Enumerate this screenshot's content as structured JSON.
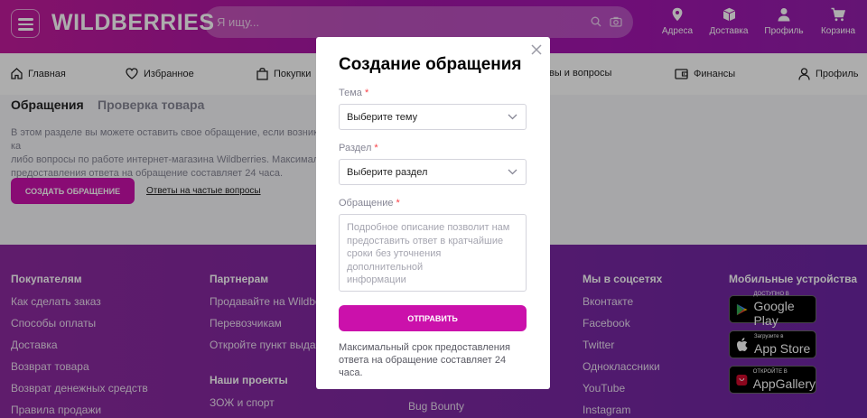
{
  "header": {
    "logo": "WILDBERRIES",
    "search_placeholder": "Я ищу...",
    "nav": [
      {
        "label": "Адреса",
        "icon": "location-icon"
      },
      {
        "label": "Доставка",
        "icon": "box-icon"
      },
      {
        "label": "Профиль",
        "icon": "user-icon"
      },
      {
        "label": "Корзина",
        "icon": "cart-icon"
      }
    ]
  },
  "main_nav": [
    {
      "label": "Главная",
      "icon": "home-icon"
    },
    {
      "label": "Избранное",
      "icon": "heart-icon"
    },
    {
      "label": "Покупки",
      "icon": "bag-icon"
    },
    {
      "label": "вы и вопросы",
      "icon": ""
    },
    {
      "label": "Финансы",
      "icon": "wallet-icon"
    },
    {
      "label": "Профиль",
      "icon": "user-icon"
    }
  ],
  "page": {
    "tabs": [
      "Обращения",
      "Проверка товара"
    ],
    "intro_lines": [
      "В этом разделе вы можете оставить свое обращение, если возникли ка",
      "либо вопросы по работе интернет-магазина Wildberries. Максимальн",
      "предоставления ответа на обращение составляет 24 часа."
    ],
    "create_button": "СОЗДАТЬ ОБРАЩЕНИЕ",
    "faq_link": "Ответы на частые вопросы"
  },
  "footer": {
    "columns": [
      {
        "heading": "Покупателям",
        "links": [
          "Как сделать заказ",
          "Способы оплаты",
          "Доставка",
          "Возврат товара",
          "Возврат денежных средств",
          "Правила продажи"
        ]
      },
      {
        "heading": "Партнерам",
        "links": [
          "Продавайте на Wildbe",
          "Перевозчикам",
          "Откройте пункт выдач"
        ],
        "heading2": "Наши проекты",
        "links2": [
          "ЗОЖ и спорт"
        ]
      },
      {
        "heading": "",
        "links": [
          "Bug Bounty"
        ]
      },
      {
        "heading": "Мы в соцсетях",
        "links": [
          "Вконтакте",
          "Facebook",
          "Twitter",
          "Одноклассники",
          "YouTube",
          "Instagram"
        ]
      },
      {
        "heading": "Мобильные устройства",
        "badges": [
          {
            "small": "ДОСТУПНО В",
            "big": "Google Play",
            "icon": "google-play-icon"
          },
          {
            "small": "Загрузите в",
            "big": "App Store",
            "icon": "apple-icon"
          },
          {
            "small": "ОТКРОЙТЕ В",
            "big": "AppGallery",
            "icon": "huawei-icon"
          }
        ]
      }
    ]
  },
  "modal": {
    "title": "Создание обращения",
    "topic_label": "Тема",
    "topic_value": "Выберите тему",
    "section_label": "Раздел",
    "section_value": "Выберите раздел",
    "message_label": "Обращение",
    "message_placeholder_lines": [
      "Подробное описание позволит нам",
      "предоставить ответ в кратчайшие",
      "сроки без уточнения дополнительной",
      "информации"
    ],
    "required_mark": "*",
    "send_button": "ОТПРАВИТЬ",
    "note": "Максимальный срок предоставления ответа на обращение составляет 24 часа."
  },
  "colors": {
    "brand": "#cb11ab",
    "required": "#f84147"
  }
}
